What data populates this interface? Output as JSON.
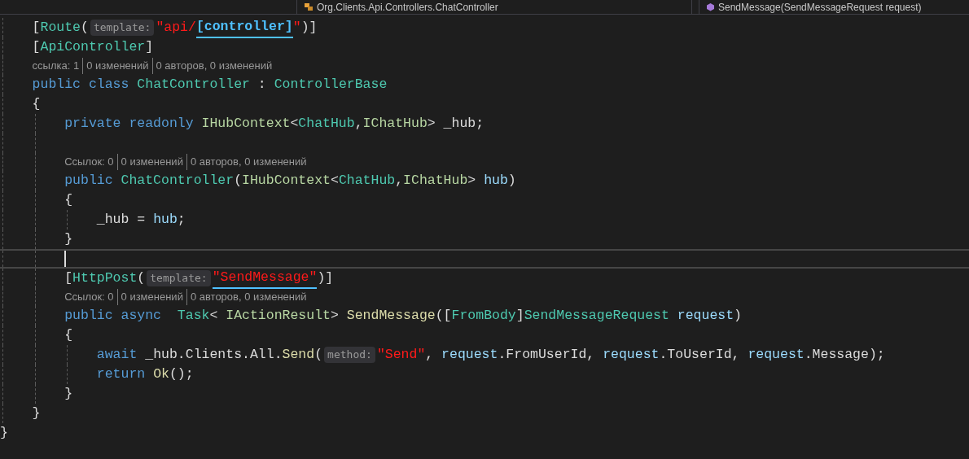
{
  "navigation_bar": {
    "type_path": "Org.Clients.Api.Controllers.ChatController",
    "member": "SendMessage(SendMessageRequest request)"
  },
  "lines": [
    {
      "kind": "block",
      "children": [
        {
          "kind": "code",
          "current": false,
          "tokens": [
            {
              "kind": "punc",
              "text": "["
            },
            {
              "kind": "type",
              "text": "Route"
            },
            {
              "kind": "punc",
              "text": "("
            },
            {
              "kind": "hint",
              "text": "template:"
            },
            {
              "kind": "str",
              "text": "\"api/"
            },
            {
              "kind": "strtok",
              "text": "[controller]"
            },
            {
              "kind": "str",
              "text": "\""
            },
            {
              "kind": "punc",
              "text": ")]"
            }
          ]
        },
        {
          "kind": "code",
          "current": false,
          "tokens": [
            {
              "kind": "punc",
              "text": "["
            },
            {
              "kind": "type",
              "text": "ApiController"
            },
            {
              "kind": "punc",
              "text": "]"
            }
          ]
        },
        {
          "kind": "lens",
          "segments": [
            "ссылка: 1",
            "0 изменений",
            "0 авторов, 0 изменений"
          ]
        },
        {
          "kind": "code",
          "current": false,
          "tokens": [
            {
              "kind": "kw",
              "text": "public class "
            },
            {
              "kind": "type",
              "text": "ChatController"
            },
            {
              "kind": "punc",
              "text": " : "
            },
            {
              "kind": "type",
              "text": "ControllerBase"
            }
          ]
        },
        {
          "kind": "code",
          "current": false,
          "tokens": [
            {
              "kind": "punc",
              "text": "{"
            }
          ],
          "children": [
            {
              "kind": "code",
              "current": false,
              "tokens": [
                {
                  "kind": "kw",
                  "text": "private readonly "
                },
                {
                  "kind": "iface",
                  "text": "IHubContext"
                },
                {
                  "kind": "punc",
                  "text": "<"
                },
                {
                  "kind": "type",
                  "text": "ChatHub"
                },
                {
                  "kind": "punc",
                  "text": ","
                },
                {
                  "kind": "iface",
                  "text": "IChatHub"
                },
                {
                  "kind": "punc",
                  "text": "> _hub;"
                }
              ]
            },
            {
              "kind": "code",
              "current": false
            },
            {
              "kind": "lens",
              "segments": [
                "Ссылок: 0",
                "0 изменений",
                "0 авторов, 0 изменений"
              ]
            },
            {
              "kind": "code",
              "current": false,
              "tokens": [
                {
                  "kind": "kw",
                  "text": "public "
                },
                {
                  "kind": "type",
                  "text": "ChatController"
                },
                {
                  "kind": "punc",
                  "text": "("
                },
                {
                  "kind": "iface",
                  "text": "IHubContext"
                },
                {
                  "kind": "punc",
                  "text": "<"
                },
                {
                  "kind": "type",
                  "text": "ChatHub"
                },
                {
                  "kind": "punc",
                  "text": ","
                },
                {
                  "kind": "iface",
                  "text": "IChatHub"
                },
                {
                  "kind": "punc",
                  "text": "> "
                },
                {
                  "kind": "param",
                  "text": "hub"
                },
                {
                  "kind": "punc",
                  "text": ")"
                }
              ]
            },
            {
              "kind": "code",
              "current": false,
              "tokens": [
                {
                  "kind": "punc",
                  "text": "{"
                }
              ],
              "children": [
                {
                  "kind": "code",
                  "current": false,
                  "tokens": [
                    {
                      "kind": "punc",
                      "text": "_hub = "
                    },
                    {
                      "kind": "param",
                      "text": "hub"
                    },
                    {
                      "kind": "punc",
                      "text": ";"
                    }
                  ]
                }
              ]
            },
            {
              "kind": "code",
              "current": false,
              "tokens": [
                {
                  "kind": "punc",
                  "text": "}"
                }
              ]
            },
            {
              "kind": "code",
              "current": true
            },
            {
              "kind": "code",
              "current": false,
              "tokens": [
                {
                  "kind": "punc",
                  "text": "["
                },
                {
                  "kind": "type",
                  "text": "HttpPost"
                },
                {
                  "kind": "punc",
                  "text": "("
                },
                {
                  "kind": "hint",
                  "text": "template:"
                },
                {
                  "kind": "strline",
                  "text": "\"SendMessage\""
                },
                {
                  "kind": "punc",
                  "text": ")]"
                }
              ]
            },
            {
              "kind": "lens",
              "segments": [
                "Ссылок: 0",
                "0 изменений",
                "0 авторов, 0 изменений"
              ]
            },
            {
              "kind": "code",
              "current": false,
              "tokens": [
                {
                  "kind": "kw",
                  "text": "public async  "
                },
                {
                  "kind": "type",
                  "text": "Task"
                },
                {
                  "kind": "punc",
                  "text": "< "
                },
                {
                  "kind": "iface",
                  "text": "IActionResult"
                },
                {
                  "kind": "punc",
                  "text": "> "
                },
                {
                  "kind": "method",
                  "text": "SendMessage"
                },
                {
                  "kind": "punc",
                  "text": "(["
                },
                {
                  "kind": "type",
                  "text": "FromBody"
                },
                {
                  "kind": "punc",
                  "text": "]"
                },
                {
                  "kind": "type",
                  "text": "SendMessageRequest"
                },
                {
                  "kind": "param",
                  "text": " request"
                },
                {
                  "kind": "punc",
                  "text": ")"
                }
              ]
            },
            {
              "kind": "code",
              "current": false,
              "tokens": [
                {
                  "kind": "punc",
                  "text": "{"
                }
              ],
              "children": [
                {
                  "kind": "code",
                  "current": false,
                  "tokens": [
                    {
                      "kind": "kw",
                      "text": "await "
                    },
                    {
                      "kind": "punc",
                      "text": "_hub.Clients.All."
                    },
                    {
                      "kind": "method",
                      "text": "Send"
                    },
                    {
                      "kind": "punc",
                      "text": "("
                    },
                    {
                      "kind": "hint",
                      "text": "method:"
                    },
                    {
                      "kind": "str",
                      "text": "\"Send\""
                    },
                    {
                      "kind": "punc",
                      "text": ", "
                    },
                    {
                      "kind": "param",
                      "text": "request"
                    },
                    {
                      "kind": "punc",
                      "text": ".FromUserId, "
                    },
                    {
                      "kind": "param",
                      "text": "request"
                    },
                    {
                      "kind": "punc",
                      "text": ".ToUserId, "
                    },
                    {
                      "kind": "param",
                      "text": "request"
                    },
                    {
                      "kind": "punc",
                      "text": ".Message);"
                    }
                  ]
                },
                {
                  "kind": "code",
                  "current": false,
                  "tokens": [
                    {
                      "kind": "kw",
                      "text": "return "
                    },
                    {
                      "kind": "method",
                      "text": "Ok"
                    },
                    {
                      "kind": "punc",
                      "text": "();"
                    }
                  ]
                }
              ]
            },
            {
              "kind": "code",
              "current": false,
              "tokens": [
                {
                  "kind": "punc",
                  "text": "}"
                }
              ]
            }
          ]
        },
        {
          "kind": "code",
          "current": false,
          "tokens": [
            {
              "kind": "punc",
              "text": "}"
            }
          ]
        }
      ]
    },
    {
      "kind": "code",
      "current": false,
      "tokens": [
        {
          "kind": "punc",
          "text": "}"
        }
      ]
    }
  ]
}
